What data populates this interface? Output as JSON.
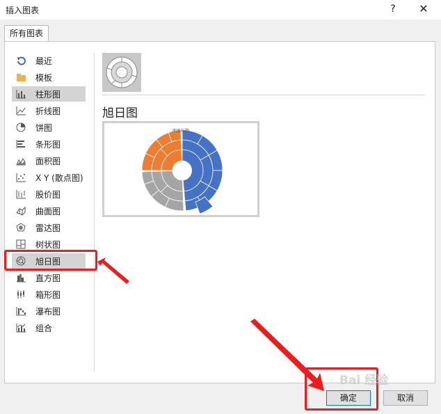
{
  "window": {
    "title": "插入图表",
    "help": "?",
    "close": "✕"
  },
  "tab": {
    "label": "所有图表"
  },
  "categories": [
    {
      "label": "最近",
      "icon": "recent-icon"
    },
    {
      "label": "模板",
      "icon": "folder-icon"
    },
    {
      "label": "柱形图",
      "icon": "column-chart-icon"
    },
    {
      "label": "折线图",
      "icon": "line-chart-icon"
    },
    {
      "label": "饼图",
      "icon": "pie-chart-icon"
    },
    {
      "label": "条形图",
      "icon": "bar-chart-icon"
    },
    {
      "label": "面积图",
      "icon": "area-chart-icon"
    },
    {
      "label": "X Y (散点图)",
      "icon": "scatter-chart-icon"
    },
    {
      "label": "股价图",
      "icon": "stock-chart-icon"
    },
    {
      "label": "曲面图",
      "icon": "surface-chart-icon"
    },
    {
      "label": "雷达图",
      "icon": "radar-chart-icon"
    },
    {
      "label": "树状图",
      "icon": "treemap-chart-icon"
    },
    {
      "label": "旭日图",
      "icon": "sunburst-chart-icon"
    },
    {
      "label": "直方图",
      "icon": "histogram-chart-icon"
    },
    {
      "label": "箱形图",
      "icon": "boxwhisker-chart-icon"
    },
    {
      "label": "瀑布图",
      "icon": "waterfall-chart-icon"
    },
    {
      "label": "组合",
      "icon": "combo-chart-icon"
    }
  ],
  "selected_category": "旭日图",
  "subtype": {
    "name": "旭日图",
    "preview_title": "图表标题"
  },
  "colors": {
    "blue": "#4472c4",
    "orange": "#ed7d31",
    "gray": "#a5a5a5",
    "red": "#ee1c1c"
  },
  "buttons": {
    "ok": "确定",
    "cancel": "取消"
  },
  "watermark": "Bai 经验"
}
